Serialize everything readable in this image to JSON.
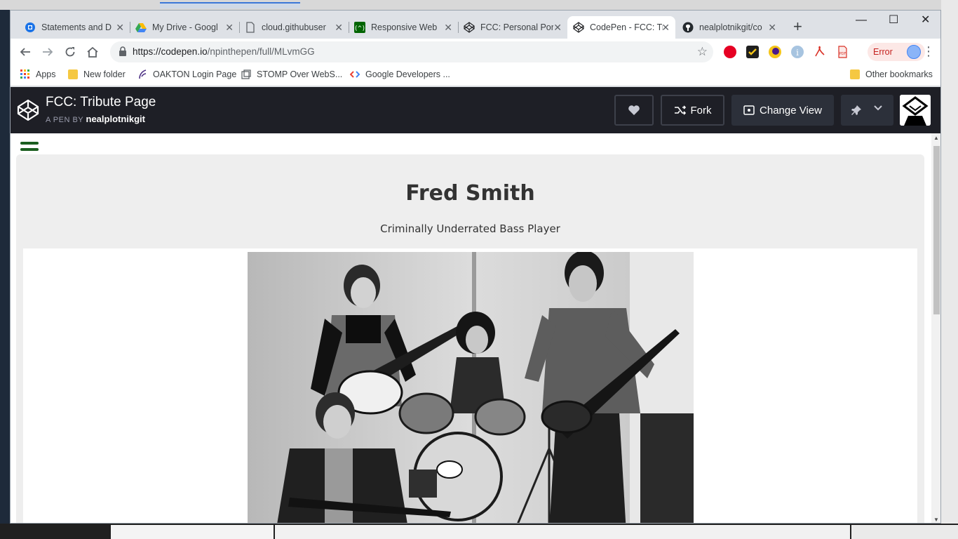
{
  "browser": {
    "tabs": [
      {
        "title": "Statements and D",
        "icon": "bank-icon",
        "active": false
      },
      {
        "title": "My Drive - Googl",
        "icon": "google-drive-icon",
        "active": false
      },
      {
        "title": "cloud.githubuser",
        "icon": "page-icon",
        "active": false
      },
      {
        "title": "Responsive Web",
        "icon": "fcc-icon",
        "active": false
      },
      {
        "title": "FCC: Personal Por",
        "icon": "codepen-icon",
        "active": false
      },
      {
        "title": "CodePen - FCC: Tr",
        "icon": "codepen-icon",
        "active": true
      },
      {
        "title": "nealplotnikgit/co",
        "icon": "github-icon",
        "active": false
      }
    ],
    "url_host": "https://codepen.io",
    "url_path": "/npinthepen/full/MLvmGG",
    "error_label": "Error",
    "bookmarks": [
      {
        "label": "Apps",
        "icon": "apps-grid-icon"
      },
      {
        "label": "New folder",
        "icon": "folder-icon"
      },
      {
        "label": "OAKTON Login Page",
        "icon": "oakton-icon"
      },
      {
        "label": "STOMP Over WebS...",
        "icon": "stomp-icon"
      },
      {
        "label": "Google Developers ...",
        "icon": "google-dev-icon"
      }
    ],
    "other_bookmarks": "Other bookmarks"
  },
  "codepen": {
    "pen_title": "FCC: Tribute Page",
    "by_prefix": "A PEN BY",
    "author": "nealplotnikgit",
    "fork_label": "Fork",
    "change_view_label": "Change View"
  },
  "page": {
    "name": "Fred Smith",
    "subtitle": "Criminally Underrated Bass Player",
    "accent": "#1b5e20"
  }
}
